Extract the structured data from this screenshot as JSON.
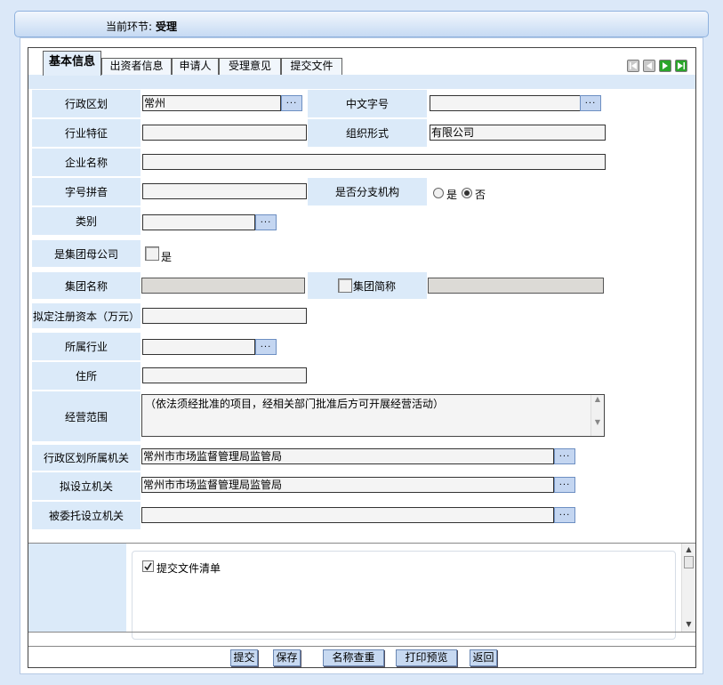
{
  "header": {
    "label": "当前环节:",
    "value": "受理"
  },
  "tabs": [
    "基本信息",
    "出资者信息",
    "申请人",
    "受理意见",
    "提交文件"
  ],
  "form": {
    "admin_region_label": "行政区划",
    "admin_region_value": "常州",
    "cn_name_label": "中文字号",
    "cn_name_value": "",
    "industry_feature_label": "行业特征",
    "industry_feature_value": "",
    "org_form_label": "组织形式",
    "org_form_value": "有限公司",
    "company_name_label": "企业名称",
    "company_name_value": "",
    "pinyin_label": "字号拼音",
    "pinyin_value": "",
    "branch_label": "是否分支机构",
    "branch_yes": "是",
    "branch_no": "否",
    "category_label": "类别",
    "category_value": "",
    "group_parent_label": "是集团母公司",
    "group_parent_check": "是",
    "group_name_label": "集团名称",
    "group_name_value": "",
    "group_short_label": "集团简称",
    "group_short_value": "",
    "capital_label": "拟定注册资本（万元）",
    "capital_value": "",
    "industry_label": "所属行业",
    "industry_value": "",
    "address_label": "住所",
    "address_value": "",
    "scope_label": "经营范围",
    "scope_value": "（依法须经批准的项目，经相关部门批准后方可开展经营活动）",
    "region_authority_label": "行政区划所属机关",
    "region_authority_value": "常州市市场监督管理局监管局",
    "proposed_authority_label": "拟设立机关",
    "proposed_authority_value": "常州市市场监督管理局监管局",
    "entrusted_authority_label": "被委托设立机关",
    "entrusted_authority_value": "",
    "ellipsis": "..."
  },
  "submit_list": {
    "label": "提交文件清单"
  },
  "buttons": {
    "submit": "提交",
    "save": "保存",
    "name_check": "名称查重",
    "print_preview": "打印预览",
    "back": "返回"
  }
}
